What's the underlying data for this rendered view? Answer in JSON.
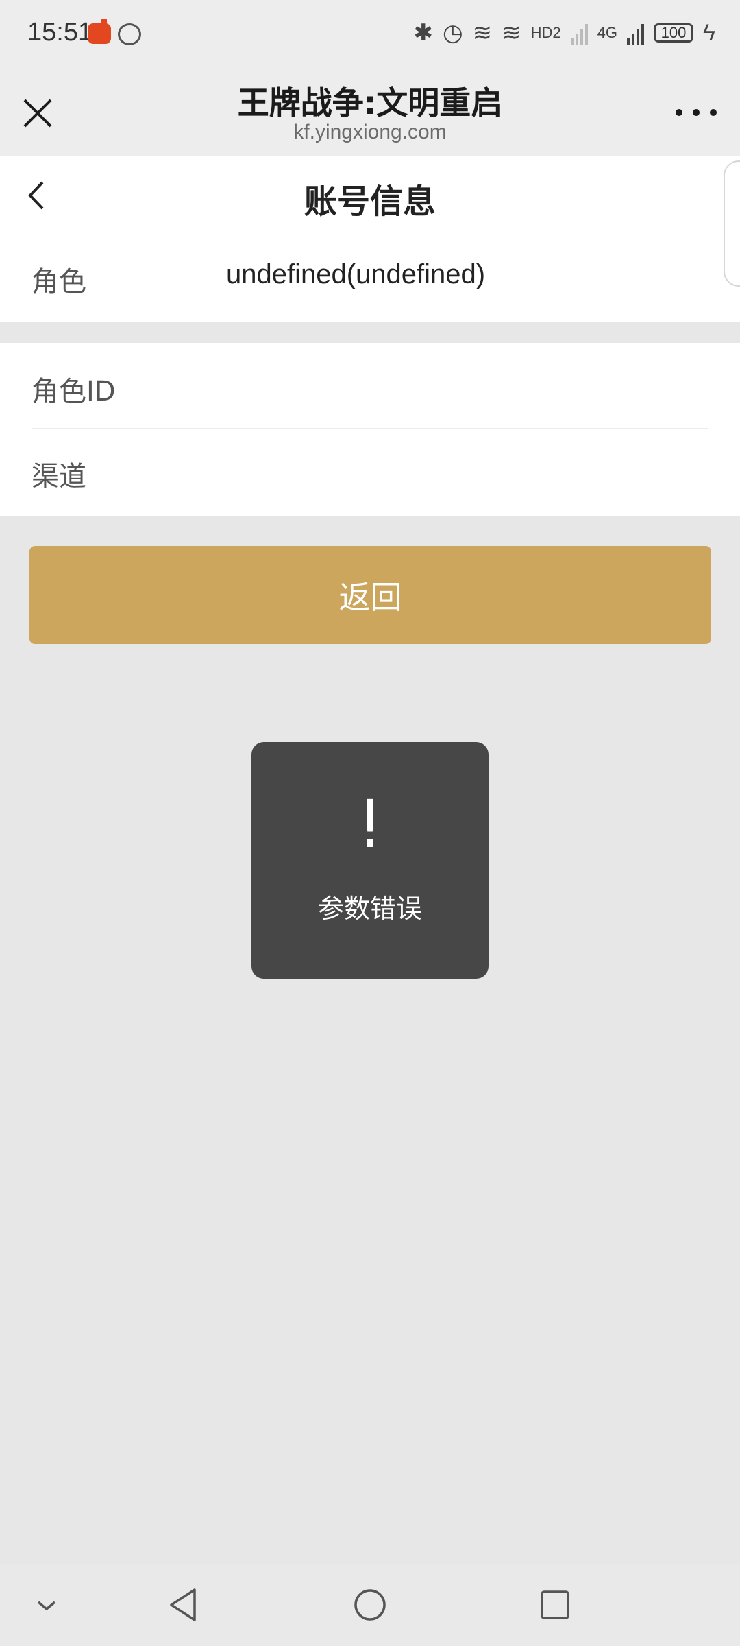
{
  "status_bar": {
    "time": "15:51",
    "network": "4G",
    "hd_label": "HD2",
    "battery": "100"
  },
  "header": {
    "title": "王牌战争:文明重启",
    "subtitle": "kf.yingxiong.com"
  },
  "page": {
    "title": "账号信息",
    "role_label": "角色",
    "role_value": "undefined(undefined)"
  },
  "info": {
    "role_id_label": "角色ID",
    "channel_label": "渠道"
  },
  "return_button": "返回",
  "toast": {
    "icon": "!",
    "message": "参数错误"
  },
  "colors": {
    "accent": "#cca65c",
    "toast_bg": "#474747",
    "page_bg": "#e7e7e7"
  },
  "icons": {
    "close": "close-icon",
    "more": "more-icon",
    "back": "chevron-left-icon",
    "nav_down": "chevron-down-icon",
    "nav_back": "triangle-back-icon",
    "nav_home": "circle-home-icon",
    "nav_recent": "square-recent-icon"
  }
}
